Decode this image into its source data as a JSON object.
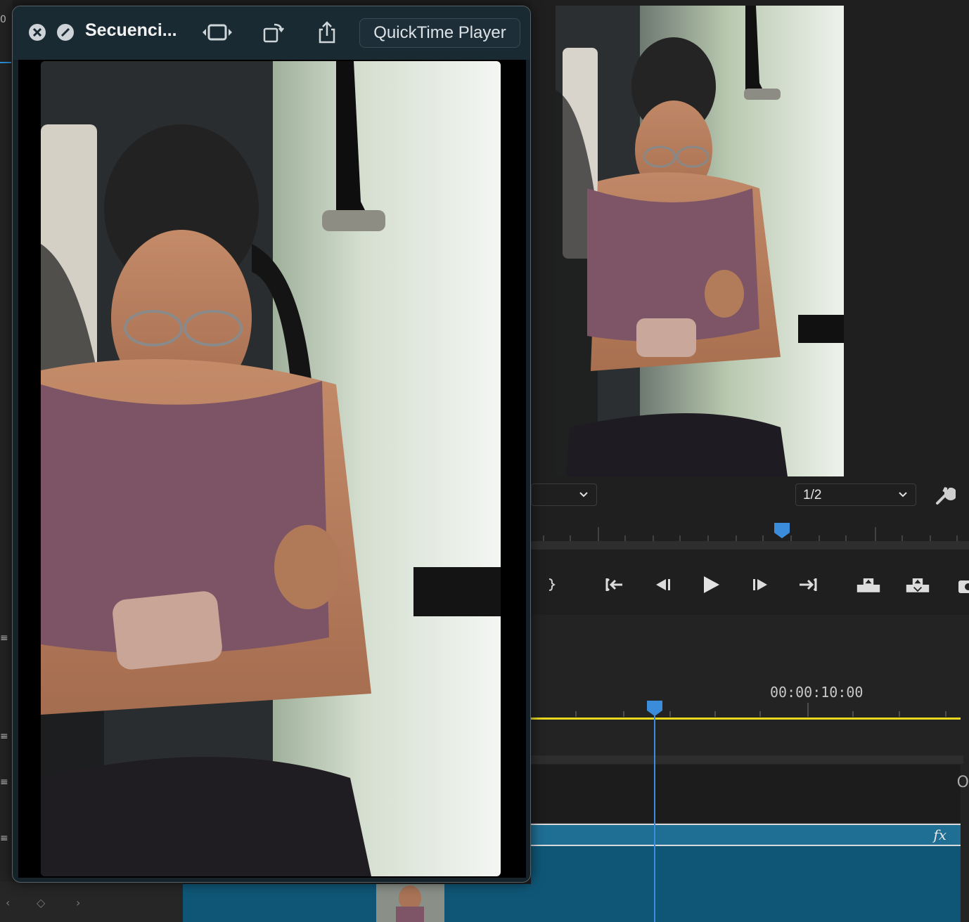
{
  "quicktime": {
    "title": "Secuenci...",
    "app_name": "QuickTime Player",
    "close_icon": "close-icon",
    "blocked_icon": "stop-icon",
    "trim_icon": "trim-icon",
    "rotate_icon": "rotate-icon",
    "share_icon": "share-icon"
  },
  "program_monitor": {
    "resolution_value": "1/2",
    "settings_icon": "wrench-icon",
    "fit_dropdown_value": ""
  },
  "transport": {
    "buttons": [
      {
        "name": "mark-out-button",
        "icon": "mark-out-icon"
      },
      {
        "name": "go-to-in-button",
        "icon": "go-to-in-icon"
      },
      {
        "name": "step-back-button",
        "icon": "step-back-icon"
      },
      {
        "name": "play-button",
        "icon": "play-icon"
      },
      {
        "name": "step-forward-button",
        "icon": "step-forward-icon"
      },
      {
        "name": "go-to-out-button",
        "icon": "go-to-out-icon"
      },
      {
        "name": "lift-button",
        "icon": "lift-icon"
      },
      {
        "name": "extract-button",
        "icon": "extract-icon"
      },
      {
        "name": "export-frame-button",
        "icon": "camera-icon"
      }
    ]
  },
  "timeline": {
    "timecode_label": "00:00:10:00",
    "clip_fx_badge": "fx"
  },
  "colors": {
    "accent_blue": "#3b8ddc",
    "work_area_yellow": "#e8d81f",
    "clip_teal": "#1f6e93"
  }
}
